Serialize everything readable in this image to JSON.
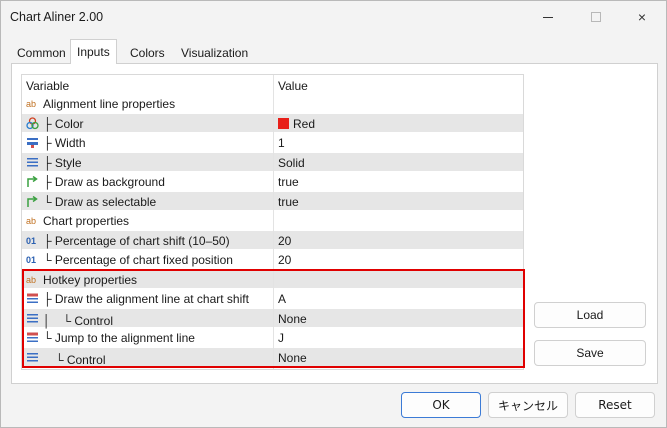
{
  "window": {
    "title": "Chart Aliner 2.00",
    "controls": {
      "minimize": "minimize",
      "maximize": "maximize",
      "close": "×"
    }
  },
  "tabs": [
    {
      "label": "Common",
      "active": false
    },
    {
      "label": "Inputs",
      "active": true
    },
    {
      "label": "Colors",
      "active": false
    },
    {
      "label": "Visualization",
      "active": false
    }
  ],
  "grid": {
    "headers": {
      "variable": "Variable",
      "value": "Value"
    },
    "rows": [
      {
        "icon": "ab-text-icon",
        "label": "Alignment line properties",
        "value": ""
      },
      {
        "icon": "color-palette-icon",
        "label": "├ Color",
        "value": "Red",
        "swatch": "#e8201a"
      },
      {
        "icon": "line-width-icon",
        "label": "├ Width",
        "value": "1"
      },
      {
        "icon": "line-style-icon",
        "label": "├ Style",
        "value": "Solid"
      },
      {
        "icon": "bool-arrow-icon",
        "label": "├ Draw as background",
        "value": "true"
      },
      {
        "icon": "bool-arrow-icon",
        "label": "└ Draw as selectable",
        "value": "true"
      },
      {
        "icon": "ab-text-icon",
        "label": "Chart properties",
        "value": ""
      },
      {
        "icon": "numeric-01-icon",
        "label": "├ Percentage of chart shift (10–50)",
        "value": "20"
      },
      {
        "icon": "numeric-01-icon",
        "label": "└ Percentage of chart fixed position",
        "value": "20"
      },
      {
        "icon": "ab-text-icon",
        "label": "Hotkey properties",
        "value": ""
      },
      {
        "icon": "enum-list-icon",
        "label": "├ Draw the alignment line at chart shift",
        "value": "A"
      },
      {
        "icon": "line-style-icon",
        "label": "│　└ Control",
        "value": "None"
      },
      {
        "icon": "enum-list-icon",
        "label": "└ Jump to the alignment line",
        "value": "J"
      },
      {
        "icon": "line-style-icon",
        "label": "　└ Control",
        "value": "None"
      }
    ]
  },
  "side_buttons": {
    "load": "Load",
    "save": "Save"
  },
  "bottom_buttons": {
    "ok": "OK",
    "cancel": "キャンセル",
    "reset": "Reset"
  },
  "colors": {
    "highlight": "#e00000",
    "accent": "#3c7bd6"
  }
}
